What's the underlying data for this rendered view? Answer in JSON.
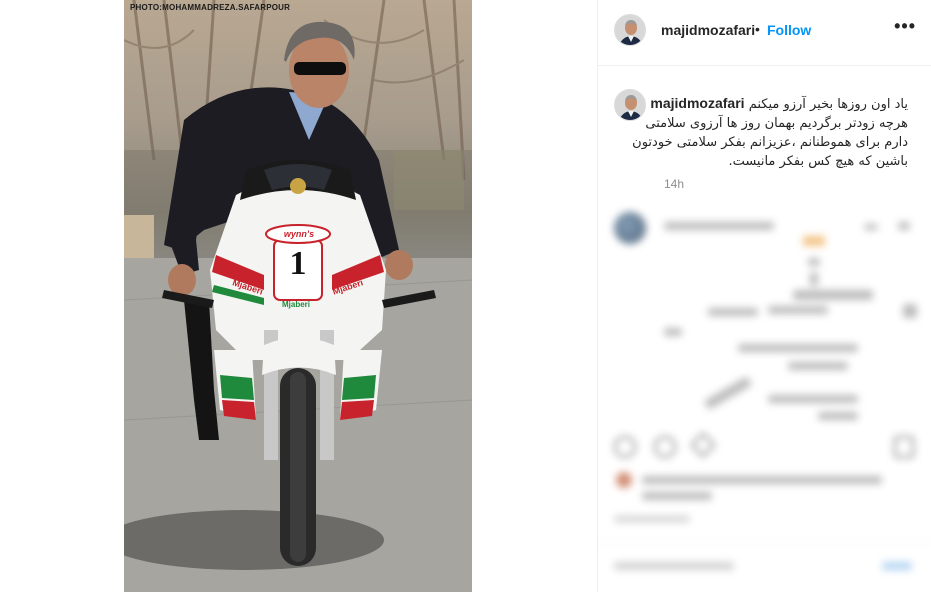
{
  "photo": {
    "watermark": "PHOTO:MOHAMMADREZA.SAFARPOUR",
    "bike_number": "1",
    "sponsor_main": "wynn's",
    "sponsor_side_1": "Mjaberi",
    "sponsor_side_2": "Mjaberi",
    "sponsor_front": "Mjaberi"
  },
  "header": {
    "username": "majidmozafari",
    "separator": "•",
    "follow_label": "Follow",
    "more_label": "•••"
  },
  "caption": {
    "username": "majidmozafari",
    "lines": [
      "یاد اون روزها بخیر آرزو میکنم",
      "هرچه زودتر برگردیم بهمان روز ها آرزوی سلامتی",
      "دارم برای هموطنانم ،عزیزانم بفکر سلامتی خودتون",
      "باشین که هیچ کس بفکر مانیست."
    ],
    "time": "14h"
  }
}
